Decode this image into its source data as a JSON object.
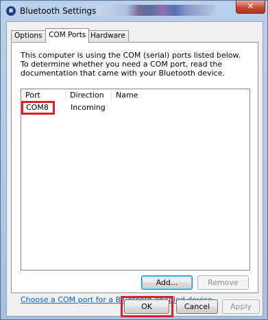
{
  "window": {
    "title": "Bluetooth Settings",
    "close_glyph": "✕",
    "title_icon": "bluetooth-icon"
  },
  "tabs": [
    {
      "label": "Options",
      "active": false
    },
    {
      "label": "COM Ports",
      "active": true
    },
    {
      "label": "Hardware",
      "active": false
    }
  ],
  "description": "This computer is using the COM (serial) ports listed below. To determine whether you need a COM port, read the documentation that came with your Bluetooth device.",
  "ports_table": {
    "columns": [
      "Port",
      "Direction",
      "Name"
    ],
    "rows": [
      {
        "port": "COM8",
        "direction": "Incoming",
        "name": ""
      }
    ]
  },
  "buttons": {
    "add": "Add...",
    "remove": "Remove",
    "ok": "OK",
    "cancel": "Cancel",
    "apply": "Apply"
  },
  "link": "Choose a COM port for a Bluetooth enabled device.",
  "colors": {
    "highlight": "#e21b24",
    "link": "#0066cc"
  }
}
